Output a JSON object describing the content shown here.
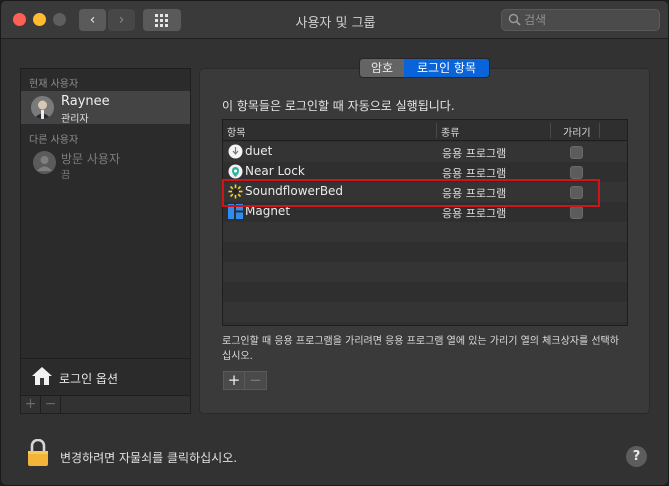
{
  "window": {
    "title": "사용자 및 그룹"
  },
  "search": {
    "placeholder": "검색"
  },
  "sidebar": {
    "current_users_label": "현재 사용자",
    "current_user": {
      "name": "Raynee",
      "role": "관리자"
    },
    "other_users_label": "다른 사용자",
    "guest_user": {
      "name": "방문 사용자",
      "status": "끔"
    },
    "login_options_label": "로그인 옵션",
    "add_label": "+",
    "remove_label": "−"
  },
  "tabs": [
    {
      "label": "암호",
      "selected": false
    },
    {
      "label": "로그인 항목",
      "selected": true
    }
  ],
  "login_items": {
    "description": "이 항목들은 로그인할 때 자동으로 실행됩니다.",
    "columns": {
      "item": "항목",
      "kind": "종류",
      "hide": "가리기"
    },
    "rows": [
      {
        "name": "duet",
        "kind": "응용 프로그램",
        "hide": false,
        "icon": "duet-icon"
      },
      {
        "name": "Near Lock",
        "kind": "응용 프로그램",
        "hide": false,
        "icon": "near-lock-icon"
      },
      {
        "name": "SoundflowerBed",
        "kind": "응용 프로그램",
        "hide": false,
        "icon": "soundflowerbed-icon",
        "highlighted": true
      },
      {
        "name": "Magnet",
        "kind": "응용 프로그램",
        "hide": false,
        "icon": "magnet-icon"
      }
    ],
    "note": "로그인할 때 응용 프로그램을 가리려면 응용 프로그램 열에 있는 가리기 열의 체크상자를 선택하십시오.",
    "add_label": "+",
    "remove_label": "−"
  },
  "footer": {
    "lock_text": "변경하려면 자물쇠를 클릭하십시오.",
    "help_label": "?"
  },
  "colors": {
    "accent": "#0a64d9",
    "highlight_border": "#d0151a"
  }
}
